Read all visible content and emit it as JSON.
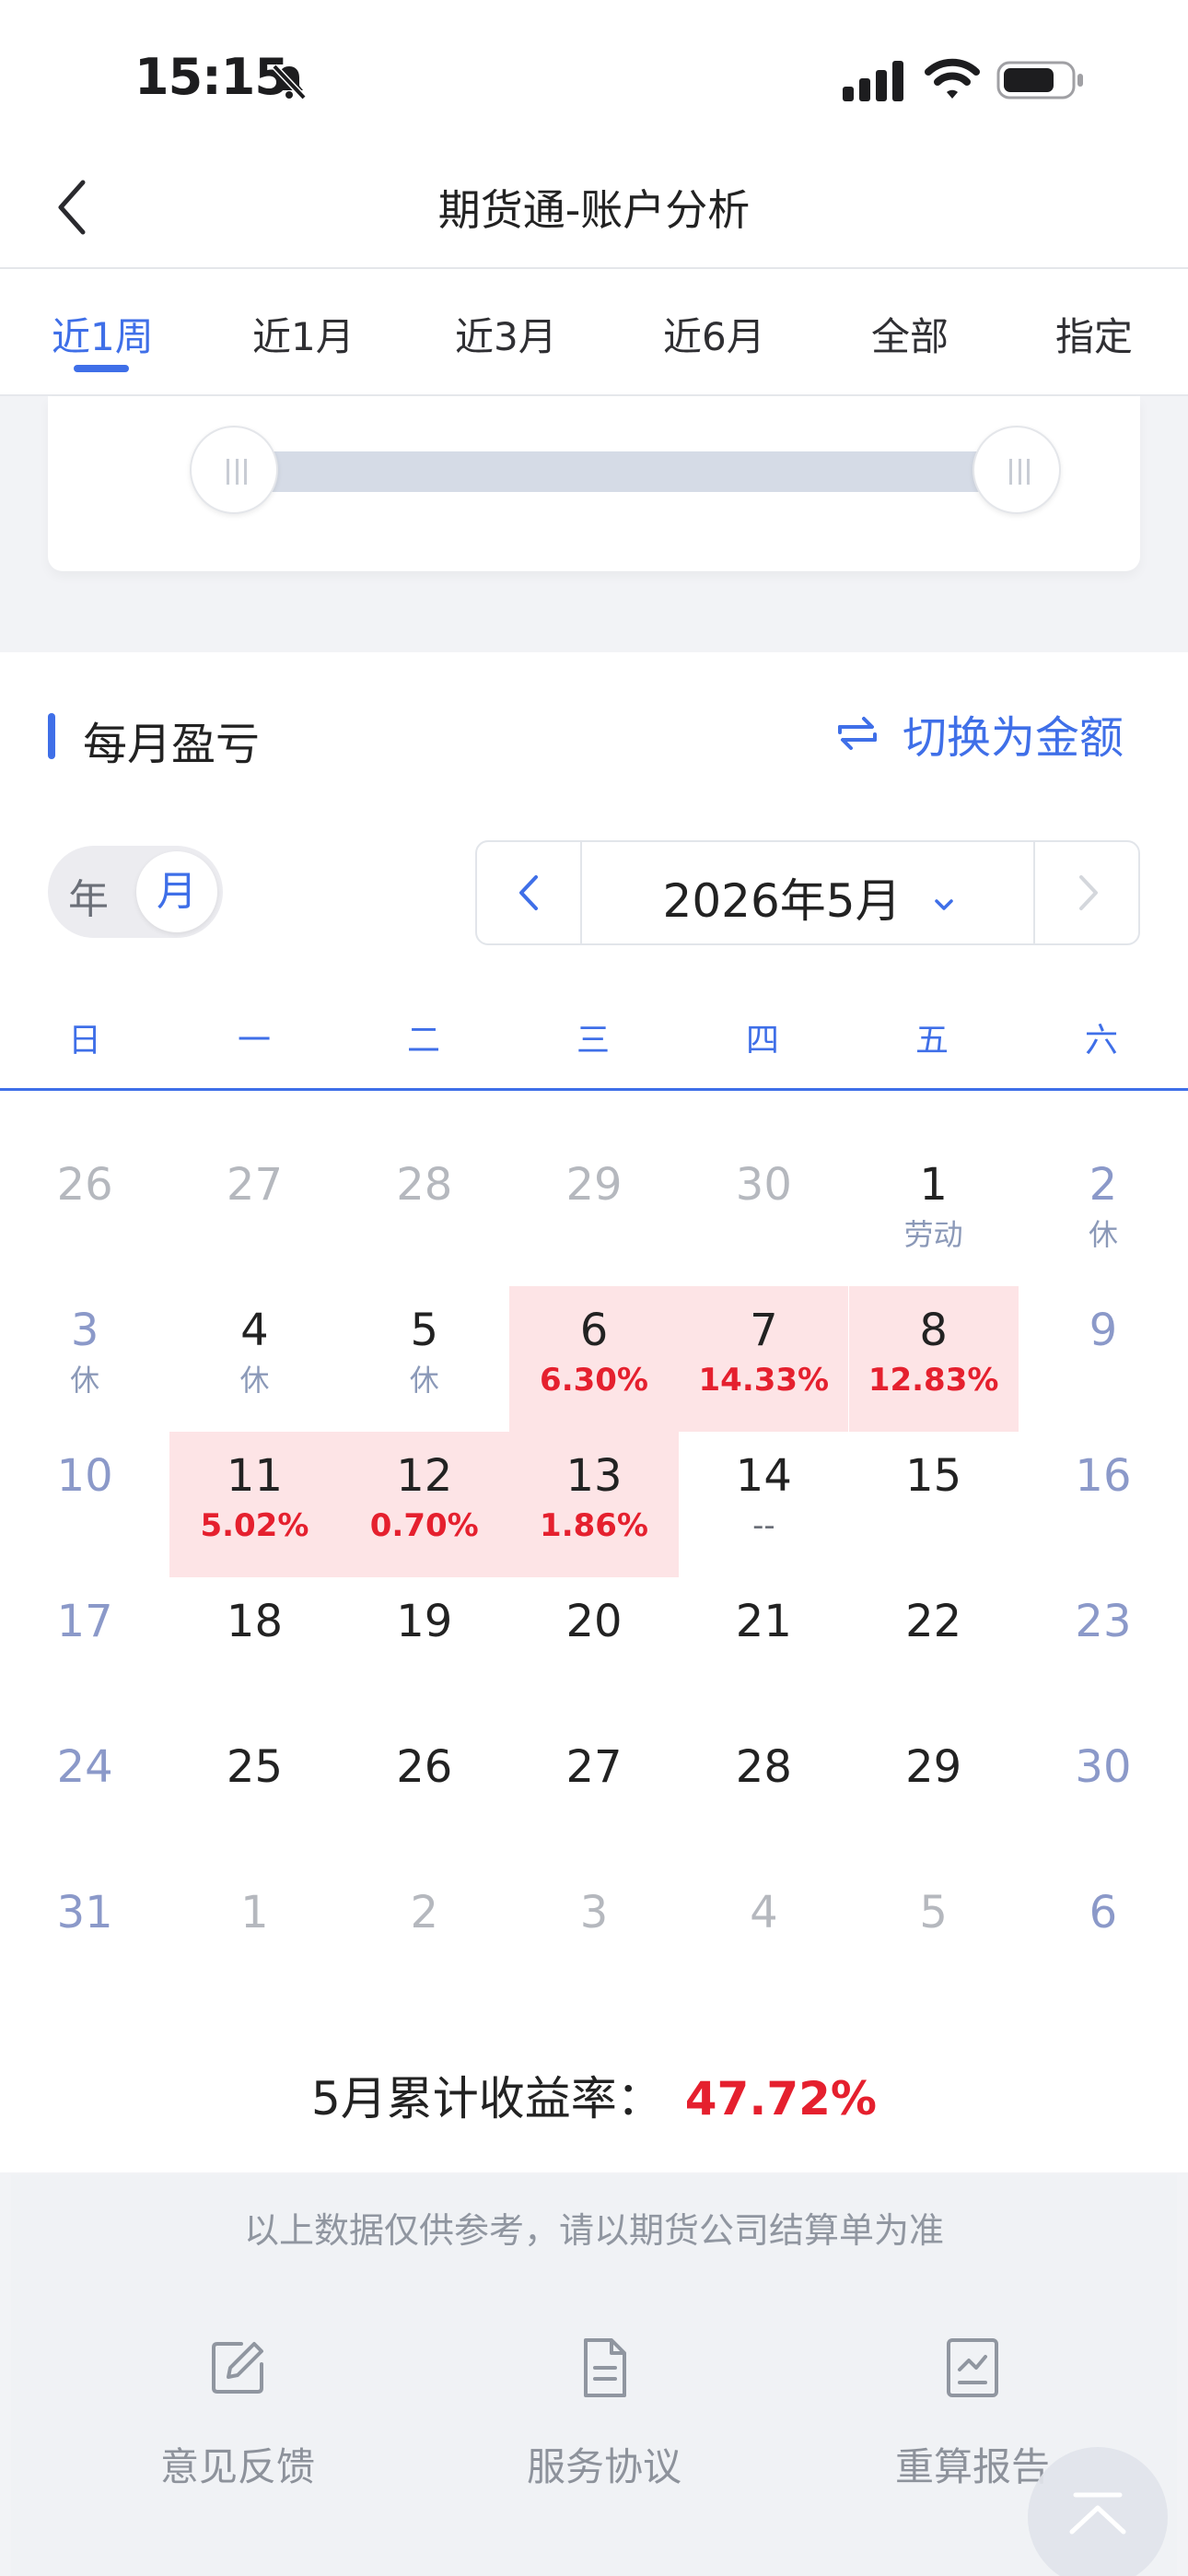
{
  "status": {
    "time": "15:15"
  },
  "nav": {
    "title": "期货通-账户分析"
  },
  "tabs": [
    {
      "label": "近1周",
      "active": true
    },
    {
      "label": "近1月"
    },
    {
      "label": "近3月"
    },
    {
      "label": "近6月"
    },
    {
      "label": "全部"
    },
    {
      "label": "指定"
    }
  ],
  "monthly": {
    "title": "每月盈亏",
    "switch_label": "切换为金额",
    "segment": {
      "year": "年",
      "month": "月"
    },
    "month_label": "2026年5月",
    "weekdays": [
      "日",
      "一",
      "二",
      "三",
      "四",
      "五",
      "六"
    ],
    "weeks": [
      [
        {
          "d": "26",
          "t": "out"
        },
        {
          "d": "27",
          "t": "out"
        },
        {
          "d": "28",
          "t": "out"
        },
        {
          "d": "29",
          "t": "out"
        },
        {
          "d": "30",
          "t": "out"
        },
        {
          "d": "1",
          "sub": "劳动"
        },
        {
          "d": "2",
          "t": "wk",
          "sub": "休"
        }
      ],
      [
        {
          "d": "3",
          "t": "wk",
          "sub": "休"
        },
        {
          "d": "4",
          "sub": "休"
        },
        {
          "d": "5",
          "sub": "休"
        },
        {
          "d": "6",
          "pct": "6.30%"
        },
        {
          "d": "7",
          "pct": "14.33%"
        },
        {
          "d": "8",
          "pct": "12.83%"
        },
        {
          "d": "9",
          "t": "wk"
        }
      ],
      [
        {
          "d": "10",
          "t": "wk"
        },
        {
          "d": "11",
          "pct": "5.02%"
        },
        {
          "d": "12",
          "pct": "0.70%"
        },
        {
          "d": "13",
          "pct": "1.86%"
        },
        {
          "d": "14",
          "dash": "--"
        },
        {
          "d": "15"
        },
        {
          "d": "16",
          "t": "wk"
        }
      ],
      [
        {
          "d": "17",
          "t": "wk"
        },
        {
          "d": "18"
        },
        {
          "d": "19"
        },
        {
          "d": "20"
        },
        {
          "d": "21"
        },
        {
          "d": "22"
        },
        {
          "d": "23",
          "t": "wk"
        }
      ],
      [
        {
          "d": "24",
          "t": "wk"
        },
        {
          "d": "25"
        },
        {
          "d": "26"
        },
        {
          "d": "27"
        },
        {
          "d": "28"
        },
        {
          "d": "29"
        },
        {
          "d": "30",
          "t": "wk"
        }
      ],
      [
        {
          "d": "31",
          "t": "wk"
        },
        {
          "d": "1",
          "t": "out"
        },
        {
          "d": "2",
          "t": "out"
        },
        {
          "d": "3",
          "t": "out"
        },
        {
          "d": "4",
          "t": "out"
        },
        {
          "d": "5",
          "t": "out"
        },
        {
          "d": "6",
          "t": "wk"
        }
      ]
    ],
    "cumulative_label": "5月累计收益率：",
    "cumulative_value": "47.72%"
  },
  "footer": {
    "disclaimer": "以上数据仅供参考，请以期货公司结算单为准",
    "items": [
      {
        "label": "意见反馈",
        "icon": "edit-icon"
      },
      {
        "label": "服务协议",
        "icon": "document-icon"
      },
      {
        "label": "重算报告",
        "icon": "report-icon"
      }
    ]
  },
  "colors": {
    "accent": "#3f6fe8",
    "profit": "#e5202e",
    "profit_bg": "#fde4e6"
  }
}
